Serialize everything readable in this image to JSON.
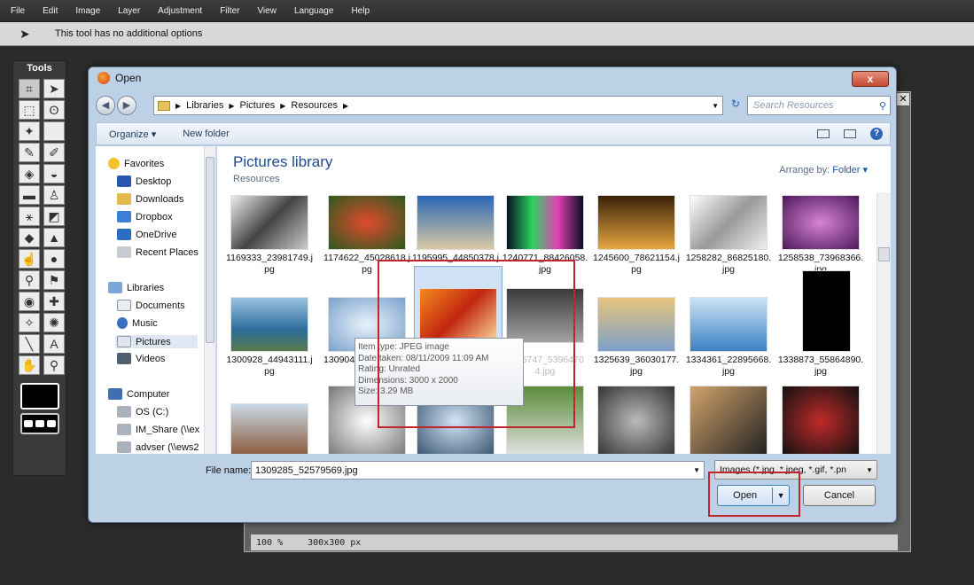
{
  "menu": [
    "File",
    "Edit",
    "Image",
    "Layer",
    "Adjustment",
    "Filter",
    "View",
    "Language",
    "Help"
  ],
  "options": {
    "text": "This tool has no additional options"
  },
  "tools": {
    "title": "Tools"
  },
  "canvas": {
    "zoom": "100 %",
    "size": "300x300 px"
  },
  "dialog": {
    "title": "Open",
    "close": "x",
    "breadcrumb": [
      "Libraries",
      "Pictures",
      "Resources"
    ],
    "search_placeholder": "Search Resources",
    "organize": "Organize ▾",
    "new_folder": "New folder",
    "library_title": "Pictures library",
    "library_sub": "Resources",
    "arrange_label": "Arrange by:",
    "arrange_value": "Folder ▾",
    "nav": {
      "favorites": "Favorites",
      "desktop": "Desktop",
      "downloads": "Downloads",
      "dropbox": "Dropbox",
      "onedrive": "OneDrive",
      "recent": "Recent Places",
      "libraries": "Libraries",
      "documents": "Documents",
      "music": "Music",
      "pictures": "Pictures",
      "videos": "Videos",
      "computer": "Computer",
      "os": "OS (C:)",
      "im_share": "IM_Share (\\\\ex",
      "advser": "advser (\\\\ews2"
    },
    "files_row1": [
      "1169333_23981749.jpg",
      "1174622_45028618.jpg",
      "1195995_44850378.jpg",
      "1240771_88426058.jpg",
      "1245600_78621154.jpg",
      "1258282_86825180.jpg",
      "1258538_73968366.jpg"
    ],
    "files_row2": [
      "1300928_44943111.jpg",
      "1309046_17868711.jpg",
      "1309",
      "1316747_5396470 4.jpg",
      "1325639_36030177.jpg",
      "1334361_22895668.jpg",
      "1338873_55864890.jpg"
    ],
    "tooltip": {
      "type": "Item type: JPEG image",
      "date": "Date taken: 08/11/2009 11:09 AM",
      "rating": "Rating: Unrated",
      "dimensions": "Dimensions: 3000 x 2000",
      "size": "Size: 3.29 MB"
    },
    "file_name_label": "File name:",
    "file_name_value": "1309285_52579569.jpg",
    "filter_value": "Images (*.jpg, *.jpeg, *.gif, *.pn",
    "open_label": "Open",
    "cancel_label": "Cancel"
  },
  "colors": {
    "accent": "#c0242f",
    "title_blue": "#1e4b8c"
  }
}
